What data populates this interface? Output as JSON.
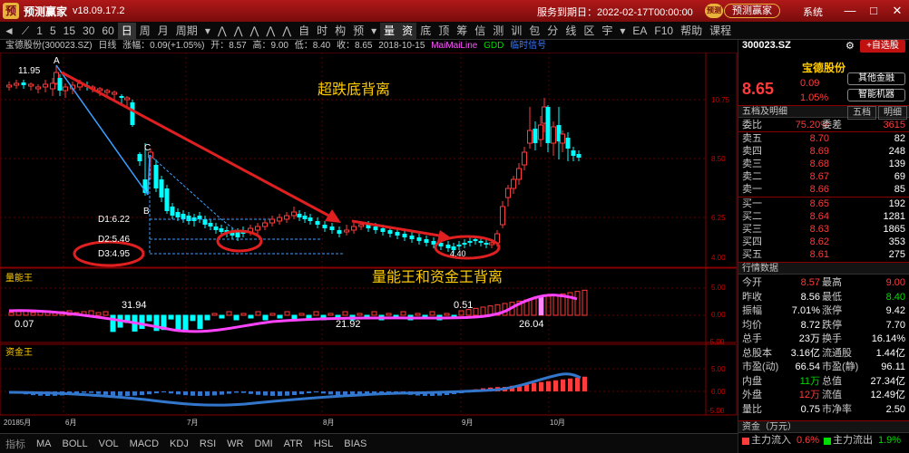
{
  "titlebar": {
    "app_name": "预测赢家",
    "version": "v18.09.17.2",
    "expire": "服务到期日：2022-02-17T00:00:00",
    "vip": "预测",
    "user": "预测赢家",
    "system": "系统",
    "min": "—",
    "max": "□",
    "close": "✕"
  },
  "toolbar": {
    "items": [
      "1",
      "5",
      "15",
      "30",
      "60",
      "日",
      "周",
      "月",
      "周期",
      "自",
      "时",
      "构",
      "预",
      "量",
      "资",
      "底",
      "顶",
      "筹",
      "信",
      "测",
      "训",
      "包",
      "分",
      "线",
      "区",
      "宇",
      "EA",
      "F10",
      "帮助",
      "课程"
    ]
  },
  "info": {
    "name": "宝德股份(300023.SZ)",
    "period": "日线",
    "change": "涨幅：0.09(+1.05%)",
    "open": "开：8.57",
    "high": "高：9.00",
    "low": "低：8.40",
    "close": "收：8.65",
    "date": "2018-10-15",
    "ma1": "MaiMaiLine",
    "ma2": "GDD",
    "ma3": "临时信号"
  },
  "chart": {
    "labels": {
      "title1": "超跌底背离",
      "title2": "量能王和资金王背离",
      "A": "A",
      "B": "B",
      "C": "C",
      "peak": "11.95",
      "d1": "D1:6.22",
      "d2": "D2:5.46",
      "d3": "D3:4.95",
      "low": "4.40",
      "p1": "10.75",
      "p2": "8.50",
      "p3": "6.25",
      "p4": "4.00"
    },
    "vol": {
      "title": "量能王",
      "v1": "31.94",
      "v2": "0.07",
      "v3": "21.92",
      "v4": "0.51",
      "v5": "26.04",
      "s1": "5.00",
      "s2": "0.00",
      "s3": "-5.00"
    },
    "fund": {
      "title": "资金王",
      "s1": "5.00",
      "s2": "0.00",
      "s3": "-5.00"
    },
    "xaxis": [
      "20185月",
      "6月",
      "7月",
      "8月",
      "9月",
      "10月"
    ]
  },
  "bottom": {
    "items": [
      "指标",
      "MA",
      "BOLL",
      "VOL",
      "MACD",
      "KDJ",
      "RSI",
      "WR",
      "DMI",
      "ATR",
      "HSL",
      "BIAS"
    ]
  },
  "right": {
    "code": "300023.SZ",
    "gear": "⚙",
    "add": "+自选股",
    "name": "宝德股份",
    "price": "8.65",
    "chg": "0.09",
    "chgp": "1.05%",
    "btn1": "其他金融",
    "btn2": "智能机器",
    "sec1": "五档及明细",
    "tab1": "五档",
    "tab2": "明细",
    "webi_label": "委比",
    "webi_val": "75.20%",
    "wecha_label": "委差",
    "wecha_val": "3615",
    "sells": [
      {
        "label": "卖五",
        "price": "8.70",
        "vol": "82"
      },
      {
        "label": "卖四",
        "price": "8.69",
        "vol": "248"
      },
      {
        "label": "卖三",
        "price": "8.68",
        "vol": "139"
      },
      {
        "label": "卖二",
        "price": "8.67",
        "vol": "69"
      },
      {
        "label": "卖一",
        "price": "8.66",
        "vol": "85"
      }
    ],
    "buys": [
      {
        "label": "买一",
        "price": "8.65",
        "vol": "192"
      },
      {
        "label": "买二",
        "price": "8.64",
        "vol": "1281"
      },
      {
        "label": "买三",
        "price": "8.63",
        "vol": "1865"
      },
      {
        "label": "买四",
        "price": "8.62",
        "vol": "353"
      },
      {
        "label": "买五",
        "price": "8.61",
        "vol": "275"
      }
    ],
    "sec2": "行情数据",
    "stats": [
      {
        "l1": "今开",
        "v1": "8.57",
        "c1": "red",
        "l2": "最高",
        "v2": "9.00",
        "c2": "red"
      },
      {
        "l1": "昨收",
        "v1": "8.56",
        "c1": "white",
        "l2": "最低",
        "v2": "8.40",
        "c2": "green"
      },
      {
        "l1": "振幅",
        "v1": "7.01%",
        "c1": "white",
        "l2": "涨停",
        "v2": "9.42",
        "c2": "white"
      },
      {
        "l1": "均价",
        "v1": "8.72",
        "c1": "white",
        "l2": "跌停",
        "v2": "7.70",
        "c2": "white"
      },
      {
        "l1": "总手",
        "v1": "23万",
        "c1": "white",
        "l2": "换手",
        "v2": "16.14%",
        "c2": "white"
      },
      {
        "l1": "总股本",
        "v1": "3.16亿",
        "c1": "white",
        "l2": "流通股",
        "v2": "1.44亿",
        "c2": "white"
      },
      {
        "l1": "市盈(动)",
        "v1": "66.54",
        "c1": "white",
        "l2": "市盈(静)",
        "v2": "96.11",
        "c2": "white"
      },
      {
        "l1": "内盘",
        "v1": "11万",
        "c1": "green",
        "l2": "总值",
        "v2": "27.34亿",
        "c2": "white"
      },
      {
        "l1": "外盘",
        "v1": "12万",
        "c1": "red",
        "l2": "流值",
        "v2": "12.49亿",
        "c2": "white"
      },
      {
        "l1": "量比",
        "v1": "0.75",
        "c1": "white",
        "l2": "市净率",
        "v2": "2.50",
        "c2": "white"
      }
    ],
    "sec3": "资金（万元）",
    "f1_label": "主力流入",
    "f1_val": "0.6%",
    "f2_label": "主力流出",
    "f2_val": "1.9%"
  }
}
